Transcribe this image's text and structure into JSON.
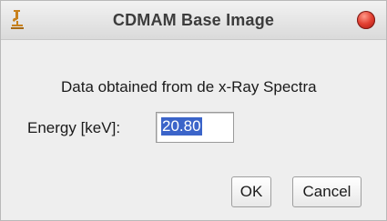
{
  "window": {
    "title": "CDMAM Base Image",
    "app_icon": "microscope-icon",
    "close_icon": "close-icon"
  },
  "dialog": {
    "message": "Data obtained from de x-Ray Spectra",
    "energy_label": "Energy [keV]:",
    "energy_value": "20.80"
  },
  "buttons": {
    "ok_label": "OK",
    "cancel_label": "Cancel"
  },
  "colors": {
    "selection": "#3b64c9",
    "close_button": "#e34133",
    "app_icon": "#c8811c"
  }
}
